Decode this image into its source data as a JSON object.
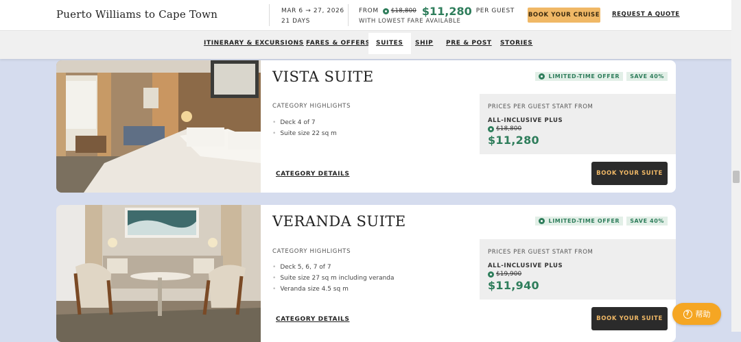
{
  "header": {
    "trip_title": "Puerto Williams to Cape Town",
    "dates": "MAR 6 → 27, 2026",
    "duration": "21 DAYS",
    "from_label": "FROM",
    "from_old_price": "$18,800",
    "from_price": "$11,280",
    "per_guest": "PER GUEST",
    "lowest_fare": "WITH LOWEST FARE AVAILABLE",
    "book_cruise": "BOOK YOUR CRUISE",
    "request_quote": "REQUEST A QUOTE"
  },
  "nav": {
    "tabs": [
      {
        "label": "ITINERARY & EXCURSIONS",
        "active": false
      },
      {
        "label": "FARES & OFFERS",
        "active": false
      },
      {
        "label": "SUITES",
        "active": true
      },
      {
        "label": "SHIP",
        "active": false
      },
      {
        "label": "PRE & POST",
        "active": false
      },
      {
        "label": "STORIES",
        "active": false
      }
    ]
  },
  "suites": [
    {
      "name": "VISTA SUITE",
      "offer": "LIMITED-TIME OFFER",
      "save": "SAVE 40%",
      "highlights_label": "CATEGORY HIGHLIGHTS",
      "highlights": [
        "Deck 4 of 7",
        "Suite size 22 sq m"
      ],
      "prices_label": "PRICES PER GUEST START FROM",
      "tier": "ALL-INCLUSIVE PLUS",
      "old_price": "$18,800",
      "price": "$11,280",
      "details_link": "CATEGORY DETAILS",
      "book_label": "BOOK YOUR SUITE"
    },
    {
      "name": "VERANDA SUITE",
      "offer": "LIMITED-TIME OFFER",
      "save": "SAVE 40%",
      "highlights_label": "CATEGORY HIGHLIGHTS",
      "highlights": [
        "Deck 5, 6, 7 of 7",
        "Suite size 27 sq m including veranda",
        "Veranda size 4.5 sq m"
      ],
      "prices_label": "PRICES PER GUEST START FROM",
      "tier": "ALL-INCLUSIVE PLUS",
      "old_price": "$19,900",
      "price": "$11,940",
      "details_link": "CATEGORY DETAILS",
      "book_label": "BOOK YOUR SUITE"
    }
  ],
  "help": {
    "label": "帮助",
    "icon": "question-circle-icon"
  },
  "colors": {
    "accent_green": "#2e7d5b",
    "gold": "#f0b866",
    "dark_button": "#2b2b2b",
    "page_bg": "#d5dcee"
  }
}
